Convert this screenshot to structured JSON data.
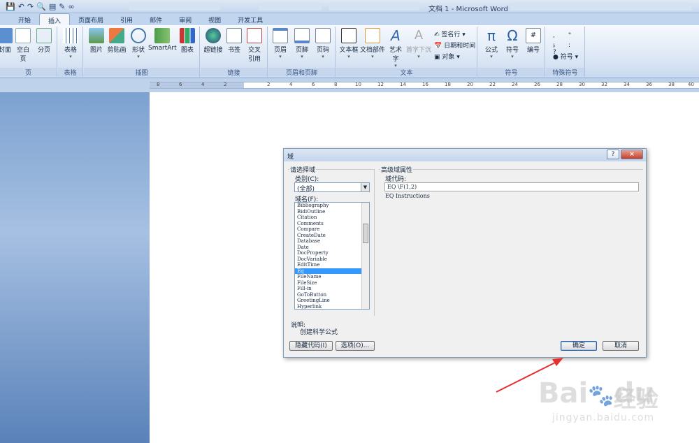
{
  "window": {
    "title": "文档 1 - Microsoft Word"
  },
  "tabs": [
    "开始",
    "插入",
    "页面布局",
    "引用",
    "邮件",
    "审阅",
    "视图",
    "开发工具"
  ],
  "ribbon": {
    "page_group": {
      "label": "页",
      "cover": "封面",
      "blank": "空白页",
      "break": "分页"
    },
    "table_group": {
      "label": "表格",
      "table": "表格"
    },
    "illus_group": {
      "label": "插图",
      "picture": "图片",
      "clipart": "剪贴画",
      "shapes": "形状",
      "smartart": "SmartArt",
      "chart": "图表"
    },
    "link_group": {
      "label": "链接",
      "hyperlink": "超链接",
      "bookmark": "书签",
      "crossref1": "交叉",
      "crossref2": "引用"
    },
    "hf_group": {
      "label": "页眉和页脚",
      "header": "页眉",
      "footer": "页脚",
      "pagenum": "页码"
    },
    "text_group": {
      "label": "文本",
      "textbox": "文本框",
      "quickparts": "文档部件",
      "wordart": "艺术字",
      "dropcap": "首字下沉",
      "signature": "签名行",
      "datetime": "日期和时间",
      "object": "对象"
    },
    "symbol_group": {
      "label": "符号",
      "equation": "公式",
      "symbol": "符号",
      "number": "编号"
    },
    "special_group": {
      "label": "特殊符号",
      "symbol": "符号"
    }
  },
  "ruler": {
    "ticks": [
      "8",
      "6",
      "4",
      "2",
      "2",
      "4",
      "6",
      "8",
      "10",
      "12",
      "14",
      "16",
      "18",
      "20",
      "22",
      "24",
      "26",
      "28",
      "30",
      "32",
      "34",
      "36",
      "38",
      "40"
    ]
  },
  "dialog": {
    "title": "域",
    "help": "?",
    "close": "×",
    "choose_field": "请选择域",
    "categories_label": "类别(C):",
    "category_value": "(全部)",
    "field_names_label": "域名(F):",
    "fields": [
      "Bibliography",
      "BidiOutline",
      "Citation",
      "Comments",
      "Compare",
      "CreateDate",
      "Database",
      "Date",
      "DocProperty",
      "DocVariable",
      "EditTime",
      "Eq",
      "FileName",
      "FileSize",
      "Fill-in",
      "GoToButton",
      "GreetingLine",
      "Hyperlink"
    ],
    "selected_field": "Eq",
    "advanced_label": "高级域属性",
    "field_codes_label": "域代码:",
    "field_code_value": "EQ \\F(1,2)",
    "instructions": "EQ Instructions",
    "description_label": "说明:",
    "description": "创建科学公式",
    "hide_codes": "隐藏代码(I)",
    "options": "选项(O)...",
    "ok": "确定",
    "cancel": "取消"
  },
  "watermark": {
    "brand": "Bai",
    "brand2": "du",
    "cn": "经验",
    "url": "jingyan.baidu.com"
  }
}
